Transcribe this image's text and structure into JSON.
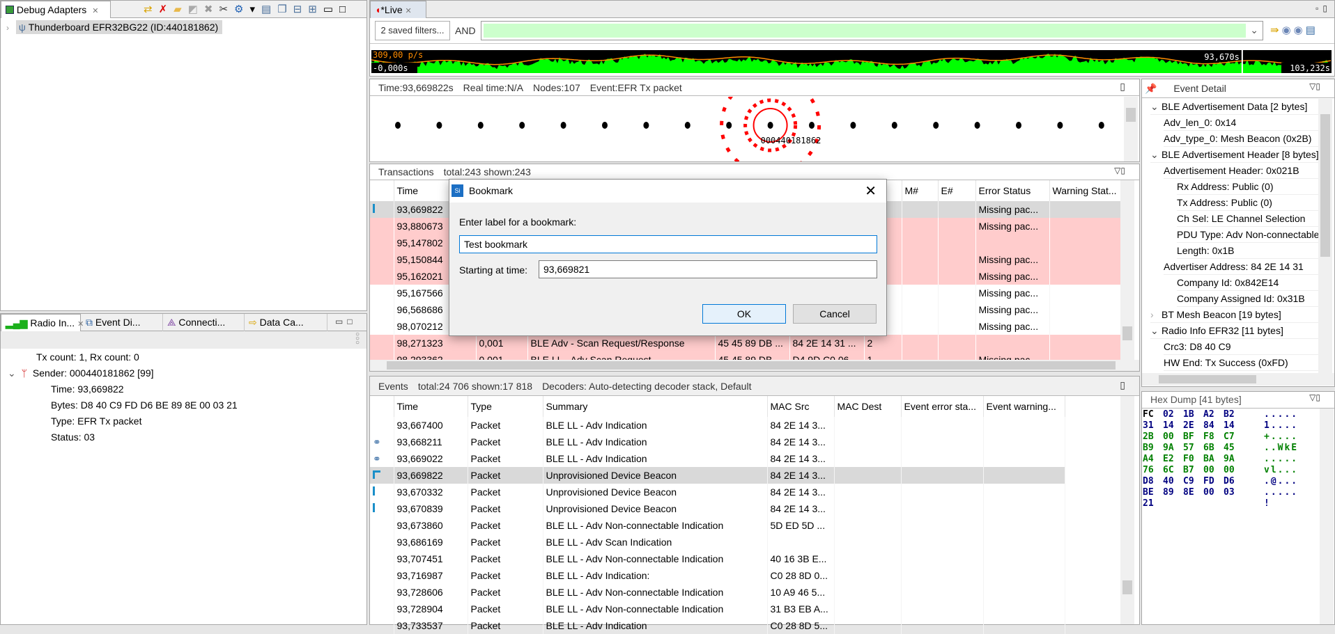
{
  "debug_adapters": {
    "tab_label": "Debug Adapters",
    "device": "Thunderboard EFR32BG22 (ID:440181862)"
  },
  "bottom_left": {
    "tabs": [
      "Radio In...",
      "Event Di...",
      "Connecti...",
      "Data Ca..."
    ],
    "counts": "Tx count: 1, Rx count: 0",
    "sender": "Sender: 000440181862 [99]",
    "details": [
      "Time: 93,669822",
      "Bytes: D8 40 C9 FD D6 BE 89 8E 00 03 21",
      "Type: EFR Tx packet",
      "Status: 03"
    ]
  },
  "editor": {
    "tab_label": "*Live",
    "filters_button": "2 saved filters...",
    "and_label": "AND",
    "filter_value": ""
  },
  "timeline": {
    "rate": "309,00 p/s",
    "start": "-0,000s",
    "cursor": "93,670s",
    "end": "103,232s",
    "cursor_fraction": 0.907,
    "colors": {
      "activity": "#00ff00",
      "rate_line": "#ff8c00"
    }
  },
  "network": {
    "time": "Time:93,669822s",
    "real_time": "Real time:N/A",
    "nodes": "Nodes:107",
    "event": "Event:EFR Tx packet",
    "selected_node_label": "000440181862",
    "highlight_color": "#ff0000"
  },
  "transactions": {
    "title": "Transactions",
    "counts": "total:243 shown:243",
    "columns": [
      "Time",
      "",
      "",
      "",
      "",
      "",
      "M#",
      "E#",
      "Error Status",
      "Warning Stat..."
    ],
    "rows": [
      {
        "state": "sel",
        "cells": [
          "93,669822",
          "",
          "",
          "",
          "",
          "",
          "",
          "",
          "Missing pac...",
          ""
        ]
      },
      {
        "state": "pink",
        "cells": [
          "93,880673",
          "",
          "",
          "",
          "",
          "",
          "",
          "",
          "Missing pac...",
          ""
        ]
      },
      {
        "state": "pink",
        "cells": [
          "95,147802",
          "",
          "",
          "",
          "",
          "",
          "",
          "",
          "",
          ""
        ]
      },
      {
        "state": "pink",
        "cells": [
          "95,150844",
          "",
          "",
          "",
          "",
          "",
          "",
          "",
          "Missing pac...",
          ""
        ]
      },
      {
        "state": "pink",
        "cells": [
          "95,162021",
          "",
          "",
          "",
          "",
          "",
          "",
          "",
          "Missing pac...",
          ""
        ]
      },
      {
        "state": "",
        "cells": [
          "95,167566",
          "",
          "",
          "",
          "",
          "",
          "",
          "",
          "Missing pac...",
          ""
        ]
      },
      {
        "state": "",
        "cells": [
          "96,568686",
          "",
          "",
          "",
          "",
          "",
          "",
          "",
          "Missing pac...",
          ""
        ]
      },
      {
        "state": "",
        "cells": [
          "98,070212",
          "",
          "",
          "",
          "",
          "",
          "",
          "",
          "Missing pac...",
          ""
        ]
      },
      {
        "state": "pink",
        "cells": [
          "98,271323",
          "0,001",
          "BLE Adv - Scan Request/Response",
          "45 45 89 DB ...",
          "84 2E 14 31 ...",
          "2",
          "",
          "",
          "",
          ""
        ]
      },
      {
        "state": "pink",
        "cells": [
          "98,293362",
          "0,001",
          "BLE LL - Adv Scan Request",
          "45 45 89 DB ...",
          "D4 9D C0 06 ...",
          "1",
          "",
          "",
          "Missing pac...",
          ""
        ]
      }
    ]
  },
  "events": {
    "title": "Events",
    "counts": "total:24 706 shown:17 818",
    "decoders": "Decoders: Auto-detecting decoder stack, Default",
    "columns": [
      "Time",
      "Type",
      "Summary",
      "MAC Src",
      "MAC Dest",
      "Event error sta...",
      "Event warning..."
    ],
    "rows": [
      {
        "marker": "",
        "state": "",
        "cells": [
          "93,667400",
          "Packet",
          "BLE LL - Adv Indication",
          "84 2E 14 3...",
          "",
          "",
          ""
        ]
      },
      {
        "marker": "link",
        "state": "",
        "cells": [
          "93,668211",
          "Packet",
          "BLE LL - Adv Indication",
          "84 2E 14 3...",
          "",
          "",
          ""
        ]
      },
      {
        "marker": "link",
        "state": "",
        "cells": [
          "93,669022",
          "Packet",
          "BLE LL - Adv Indication",
          "84 2E 14 3...",
          "",
          "",
          ""
        ]
      },
      {
        "marker": "bookmark-start",
        "state": "sel",
        "cells": [
          "93,669822",
          "Packet",
          "Unprovisioned Device Beacon",
          "84 2E 14 3...",
          "",
          "",
          ""
        ]
      },
      {
        "marker": "bar",
        "state": "",
        "cells": [
          "93,670332",
          "Packet",
          "Unprovisioned Device Beacon",
          "84 2E 14 3...",
          "",
          "",
          ""
        ]
      },
      {
        "marker": "bar",
        "state": "",
        "cells": [
          "93,670839",
          "Packet",
          "Unprovisioned Device Beacon",
          "84 2E 14 3...",
          "",
          "",
          ""
        ]
      },
      {
        "marker": "",
        "state": "",
        "cells": [
          "93,673860",
          "Packet",
          "BLE LL - Adv Non-connectable Indication",
          "5D ED 5D ...",
          "",
          "",
          ""
        ]
      },
      {
        "marker": "",
        "state": "",
        "cells": [
          "93,686169",
          "Packet",
          "BLE LL - Adv Scan Indication",
          "",
          "",
          "",
          ""
        ]
      },
      {
        "marker": "",
        "state": "",
        "cells": [
          "93,707451",
          "Packet",
          "BLE LL - Adv Non-connectable Indication",
          "40 16 3B E...",
          "",
          "",
          ""
        ]
      },
      {
        "marker": "",
        "state": "",
        "cells": [
          "93,716987",
          "Packet",
          "BLE LL - Adv Indication:",
          "C0 28 8D 0...",
          "",
          "",
          ""
        ]
      },
      {
        "marker": "",
        "state": "",
        "cells": [
          "93,728606",
          "Packet",
          "BLE LL - Adv Non-connectable Indication",
          "10 A9 46 5...",
          "",
          "",
          ""
        ]
      },
      {
        "marker": "",
        "state": "",
        "cells": [
          "93,728904",
          "Packet",
          "BLE LL - Adv Non-connectable Indication",
          "31 B3 EB A...",
          "",
          "",
          ""
        ]
      },
      {
        "marker": "",
        "state": "",
        "cells": [
          "93,733537",
          "Packet",
          "BLE LL - Adv Indication",
          "C0 28 8D 5...",
          "",
          "",
          ""
        ]
      }
    ]
  },
  "event_detail": {
    "title": "Event Detail",
    "items": [
      {
        "level": 0,
        "toggle": "expanded",
        "text": "BLE Advertisement Data [2 bytes]"
      },
      {
        "level": 1,
        "toggle": "",
        "text": "Adv_len_0: 0x14"
      },
      {
        "level": 1,
        "toggle": "",
        "text": "Adv_type_0: Mesh Beacon (0x2B)"
      },
      {
        "level": 0,
        "toggle": "expanded",
        "text": "BLE Advertisement Header [8 bytes]"
      },
      {
        "level": 1,
        "toggle": "",
        "text": "Advertisement Header: 0x021B"
      },
      {
        "level": 2,
        "toggle": "",
        "text": "Rx Address: Public (0)"
      },
      {
        "level": 2,
        "toggle": "",
        "text": "Tx Address: Public (0)"
      },
      {
        "level": 2,
        "toggle": "",
        "text": "Ch Sel: LE Channel Selection"
      },
      {
        "level": 2,
        "toggle": "",
        "text": "PDU Type: Adv Non-connectable"
      },
      {
        "level": 2,
        "toggle": "",
        "text": "Length: 0x1B"
      },
      {
        "level": 1,
        "toggle": "",
        "text": "Advertiser Address: 84 2E 14 31"
      },
      {
        "level": 2,
        "toggle": "",
        "text": "Company Id: 0x842E14"
      },
      {
        "level": 2,
        "toggle": "",
        "text": "Company Assigned Id: 0x31B"
      },
      {
        "level": 0,
        "toggle": "collapsed",
        "text": "BT Mesh Beacon [19 bytes]"
      },
      {
        "level": 0,
        "toggle": "expanded",
        "text": "Radio Info EFR32 [11 bytes]"
      },
      {
        "level": 1,
        "toggle": "",
        "text": "Crc3: D8 40 C9"
      },
      {
        "level": 1,
        "toggle": "",
        "text": "HW End: Tx Success (0xFD)"
      }
    ]
  },
  "hex_dump": {
    "title": "Hex Dump [41 bytes]",
    "rows": [
      {
        "color": "#000080",
        "bytes": [
          "FC",
          "02",
          "1B",
          "A2",
          "B2"
        ],
        "ascii": "....."
      },
      {
        "color": "#000080",
        "bytes": [
          "31",
          "14",
          "2E",
          "84",
          "14"
        ],
        "ascii": "1...."
      },
      {
        "color": "#008000",
        "bytes": [
          "2B",
          "00",
          "BF",
          "F8",
          "C7"
        ],
        "ascii": "+...."
      },
      {
        "color": "#008000",
        "bytes": [
          "B9",
          "9A",
          "57",
          "6B",
          "45"
        ],
        "ascii": "..WkE"
      },
      {
        "color": "#008000",
        "bytes": [
          "A4",
          "E2",
          "F0",
          "BA",
          "9A"
        ],
        "ascii": "....."
      },
      {
        "color": "#008000",
        "bytes": [
          "76",
          "6C",
          "B7",
          "00",
          "00"
        ],
        "ascii": "vl..."
      },
      {
        "color": "#000080",
        "bytes": [
          "D8",
          "40",
          "C9",
          "FD",
          "D6"
        ],
        "ascii": ".@..."
      },
      {
        "color": "#000080",
        "bytes": [
          "BE",
          "89",
          "8E",
          "00",
          "03"
        ],
        "ascii": "....."
      },
      {
        "color": "#000080",
        "bytes": [
          "21"
        ],
        "ascii": "!"
      }
    ]
  },
  "dialog": {
    "title": "Bookmark",
    "prompt": "Enter label for a bookmark:",
    "label_value": "Test bookmark",
    "time_label": "Starting at time:",
    "time_value": "93,669821",
    "ok": "OK",
    "cancel": "Cancel"
  }
}
